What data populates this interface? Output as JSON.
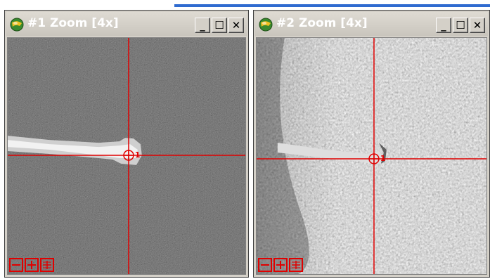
{
  "windows": [
    {
      "title": "#1 Zoom [4x]",
      "controls": {
        "minimize": "_",
        "maximize": "☐",
        "close": "✕"
      },
      "marker_label": "1",
      "layout_icons": [
        "single-view-icon",
        "cross-view-icon",
        "quad-view-icon"
      ]
    },
    {
      "title": "#2 Zoom [4x]",
      "controls": {
        "minimize": "_",
        "maximize": "☐",
        "close": "✕"
      },
      "marker_label": "1",
      "layout_icons": [
        "single-view-icon",
        "cross-view-icon",
        "quad-view-icon"
      ]
    }
  ],
  "colors": {
    "crosshair": "#e00000",
    "window_frame": "#d4d0c8",
    "title_text": "#ffffff",
    "accent": "#2f6bd0"
  }
}
